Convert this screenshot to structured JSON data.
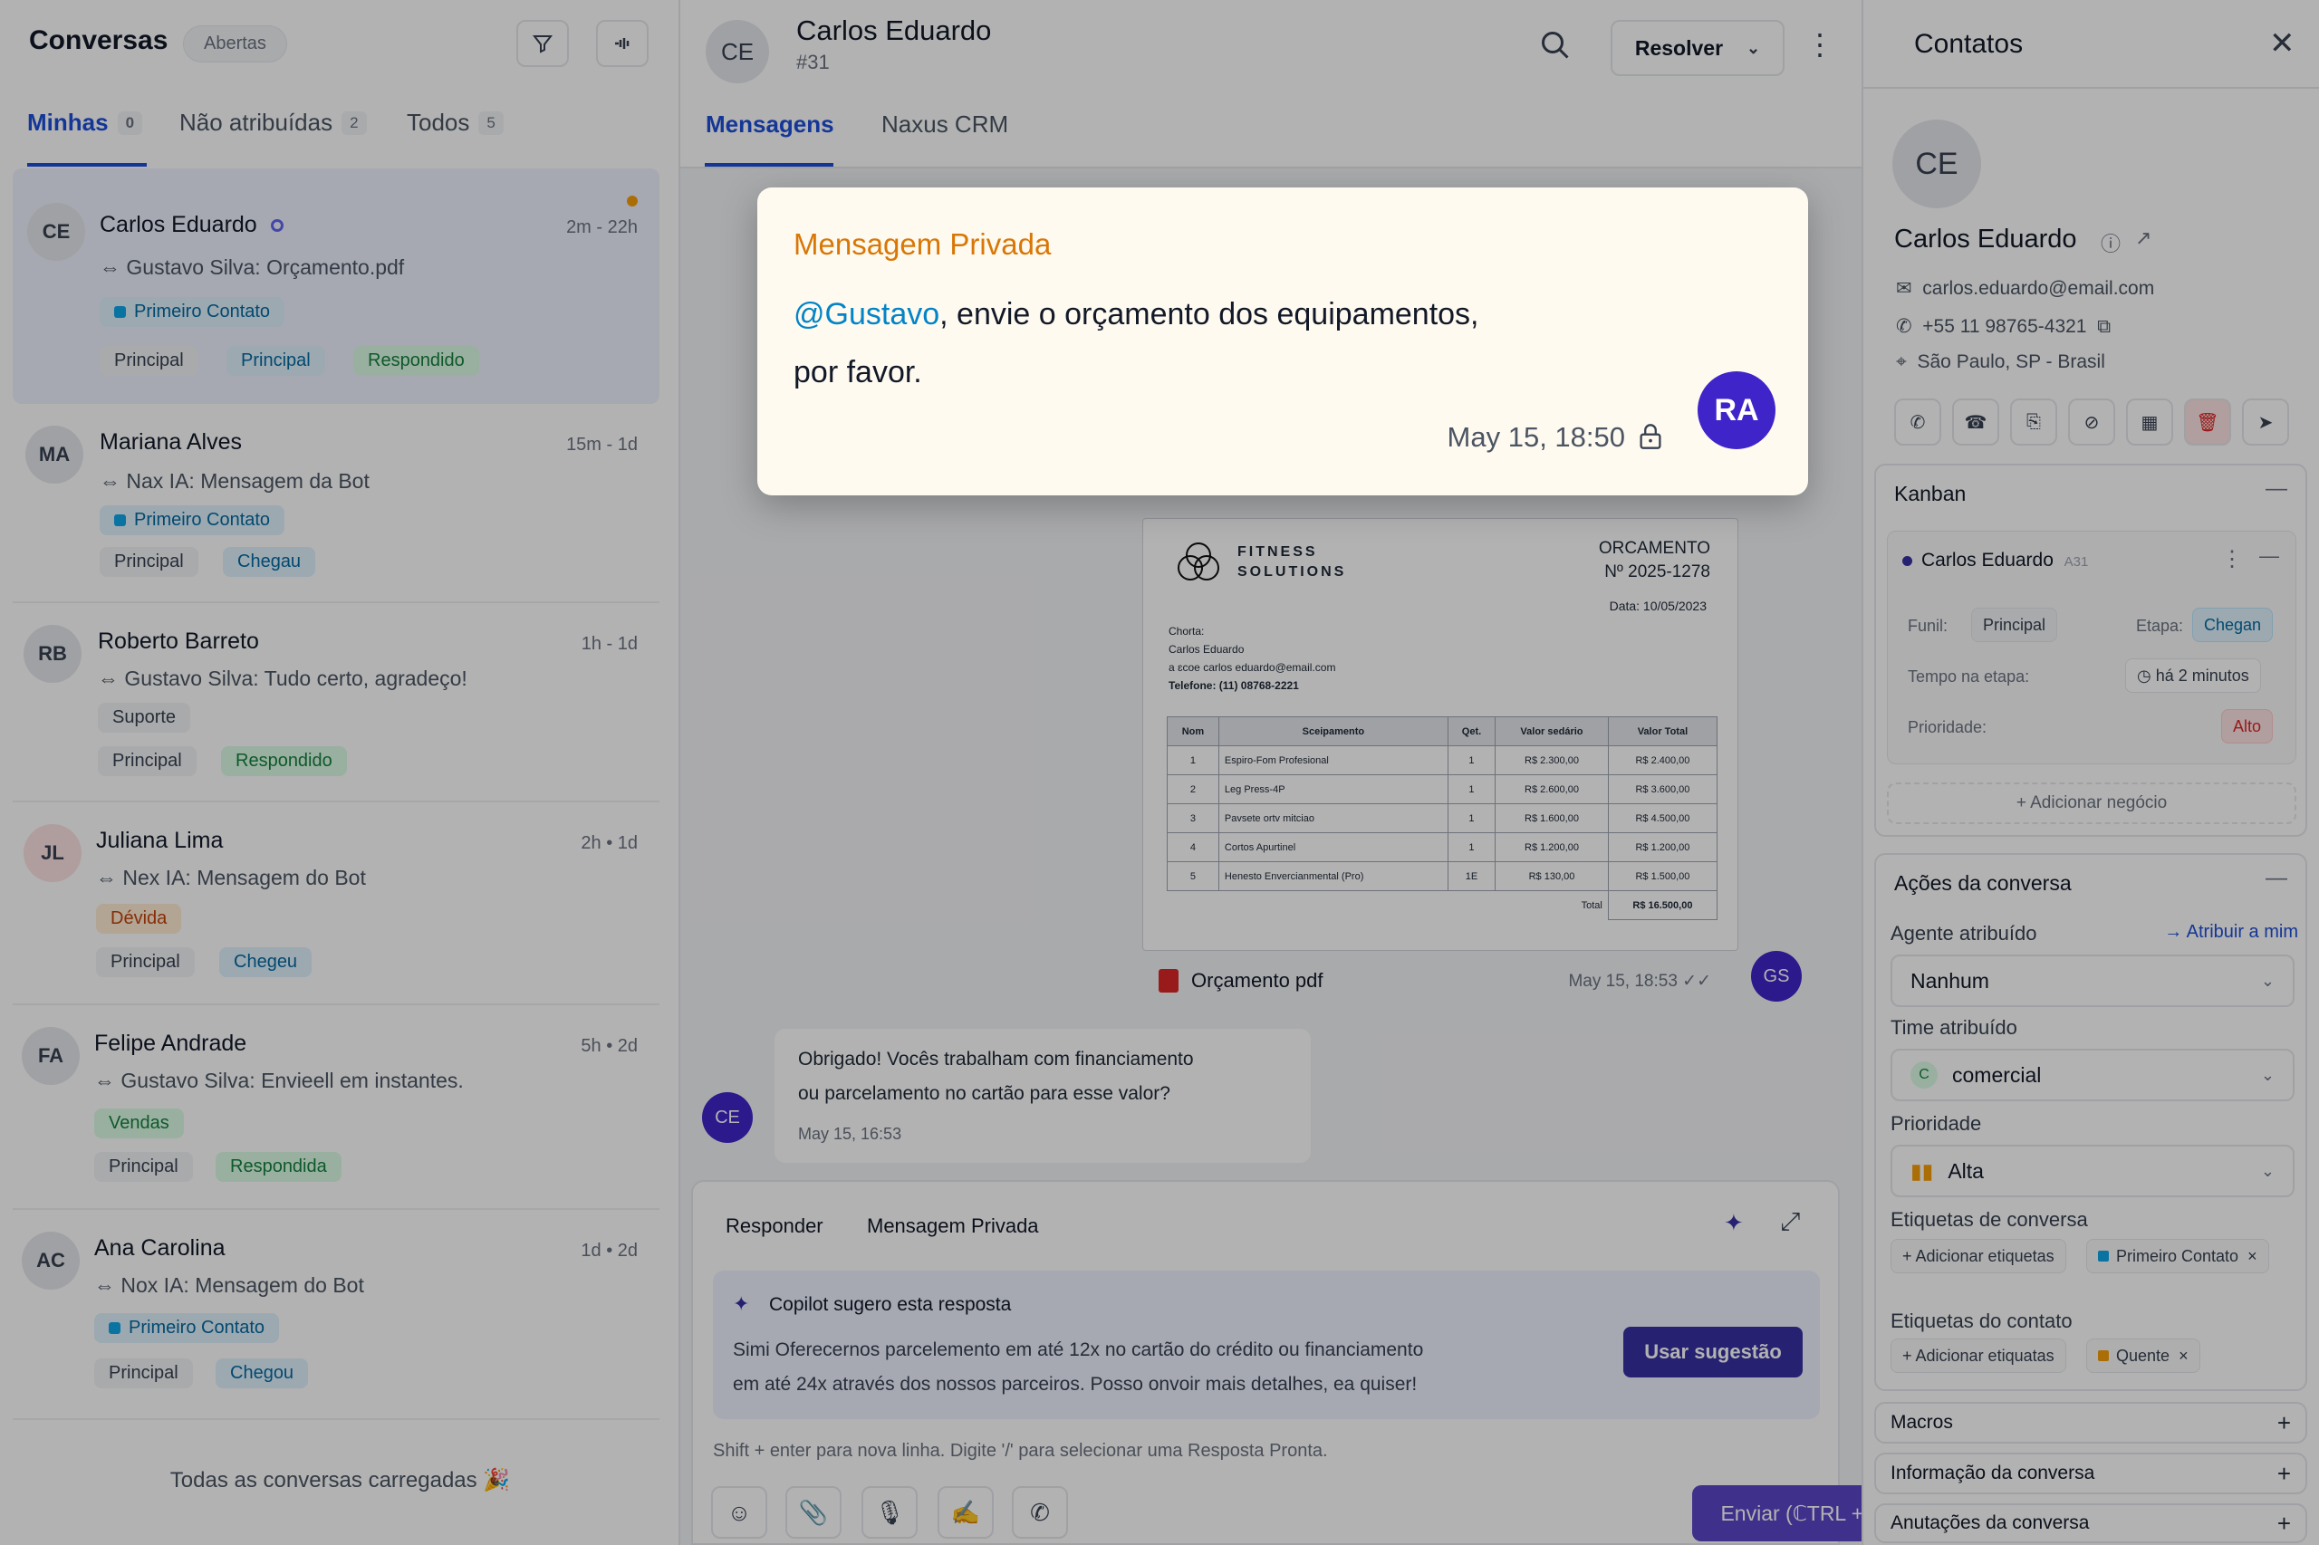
{
  "left": {
    "title": "Conversas",
    "status_pill": "Abertas",
    "filter_icon": "filter-icon",
    "sort_icon": "sort-icon",
    "tabs": [
      {
        "label": "Minhas",
        "count": "0"
      },
      {
        "label": "Não atribuídas",
        "count": "2"
      },
      {
        "label": "Todos",
        "count": "5"
      }
    ],
    "conversations": [
      {
        "initials": "CE",
        "name": "Carlos Eduardo",
        "time": "2m - 22h",
        "preview": "Gustavo Silva: Orçamento.pdf",
        "label": "Primeiro Contato",
        "tags": [
          "Principal",
          "Principal",
          "Respondido"
        ]
      },
      {
        "initials": "MA",
        "name": "Mariana Alves",
        "time": "15m - 1d",
        "preview": "Nax IA: Mensagem da Bot",
        "label": "Primeiro Contato",
        "tags": [
          "Principal",
          "Chegau"
        ]
      },
      {
        "initials": "RB",
        "name": "Roberto Barreto",
        "time": "1h - 1d",
        "preview": "Gustavo Silva: Tudo certo, agradeço!",
        "label": "Suporte",
        "tags": [
          "Principal",
          "Respondido"
        ]
      },
      {
        "initials": "JL",
        "name": "Juliana Lima",
        "time": "2h • 1d",
        "preview": "Nex IA: Mensagem do Bot",
        "label": "Dévida",
        "tags": [
          "Principal",
          "Chegeu"
        ]
      },
      {
        "initials": "FA",
        "name": "Felipe Andrade",
        "time": "5h • 2d",
        "preview": "Gustavo Silva: Envieell em instantes.",
        "label": "Vendas",
        "tags": [
          "Principal",
          "Respondida"
        ]
      },
      {
        "initials": "AC",
        "name": "Ana Carolina",
        "time": "1d • 2d",
        "preview": "Nox IA: Mensagem do Bot",
        "label": "Primeiro Contato",
        "tags": [
          "Principal",
          "Chegou"
        ]
      }
    ],
    "footer": "Todas as conversas carregadas 🎉"
  },
  "center": {
    "initials": "CE",
    "name": "Carlos Eduardo",
    "number": "#31",
    "resolve_label": "Resolver",
    "tabs": [
      "Mensagens",
      "Naxus CRM"
    ],
    "doc": {
      "brand1": "FITNESS",
      "brand2": "SOLUTIONS",
      "title": "ORCAMENTO",
      "num": "Nº 2025-1278",
      "date": "Data: 10/05/2023",
      "client_lines": [
        "Chorta:",
        "Carlos Eduardo",
        "a ɛcoe carlos eduardo@email.com",
        "Telefone: (11) 08768-2221"
      ],
      "headers": [
        "Nom",
        "Sceipamento",
        "Qet.",
        "Valor sedário",
        "Valor Total"
      ],
      "rows": [
        [
          "1",
          "Espiro-Fom Profesional",
          "1",
          "R$ 2.300,00",
          "R$ 2.400,00"
        ],
        [
          "2",
          "Leg Press-4P",
          "1",
          "R$ 2.600,00",
          "R$ 3.600,00"
        ],
        [
          "3",
          "Pavsete ortv mitciao",
          "1",
          "R$ 1.600,00",
          "R$ 4.500,00"
        ],
        [
          "4",
          "Cortos Apurtinel",
          "1",
          "R$ 1.200,00",
          "R$ 1.200,00"
        ],
        [
          "5",
          "Henesto Envercianmental (Pro)",
          "1E",
          "R$ 130,00",
          "R$ 1.500,00"
        ]
      ],
      "total_label": "Total",
      "total_value": "R$ 16.500,00"
    },
    "attachment": {
      "name": "Orçamento pdf",
      "time": "May 15, 18:53 ✓✓",
      "sender": "GS"
    },
    "incoming": {
      "initials": "CE",
      "text1": "Obrigado! Vocês trabalham com financiamento",
      "text2": "ou parcelamento no cartão para esse valor?",
      "time": "May 15, 16:53"
    },
    "composer": {
      "tab_reply": "Responder",
      "tab_private": "Mensagem Privada",
      "copilot_title": "Copilot sugero esta resposta",
      "copilot_text1": "Simi Oferecernos parcelemento em até 12x no cartão do crédito ou financiamento",
      "copilot_text2": "em até 24x através dos nossos parceiros. Posso onvoir mais detalhes, ea quiser!",
      "use_label": "Usar sugestão",
      "hint": "Shift + enter para nova linha. Digite '/' para selecionar uma Resposta Pronta.",
      "send_label": "Enviar (ℂTRL + ⏎)"
    }
  },
  "popup": {
    "title": "Mensagem Privada",
    "mention": "@Gustavo",
    "text_rest": ", envie o orçamento dos equipamentos,",
    "text_line2": "por favor.",
    "time": "May 15, 18:50",
    "avatar": "RA"
  },
  "right": {
    "title": "Contatos",
    "initials": "CE",
    "name": "Carlos Eduardo",
    "email": "carlos.eduardo@email.com",
    "phone": "+55 11 98765-4321",
    "location": "São Paulo, SP - Brasil",
    "kanban": {
      "title": "Kanban",
      "deal_name": "Carlos Eduardo",
      "deal_id": "A31",
      "funnel_label": "Funil:",
      "funnel_value": "Principal",
      "stage_label": "Etapa:",
      "stage_value": "Chegan",
      "time_label": "Tempo na etapa:",
      "time_value": "há 2 minutos",
      "priority_label": "Prioridade:",
      "priority_value": "Alto",
      "add_label": "+ Adicionar negócio"
    },
    "actions": {
      "title": "Ações da conversa",
      "agent_label": "Agente atribuído",
      "assign_me": "→ Atribuir a mim",
      "agent_value": "Nanhum",
      "team_label": "Time atribuído",
      "team_value": "comercial",
      "team_initial": "C",
      "priority_label": "Prioridade",
      "priority_value": "Alta",
      "conv_tags_label": "Etiquetas de conversa",
      "conv_add": "+ Adicionar etiquetas",
      "conv_tag": "Primeiro Contato",
      "contact_tags_label": "Etiquetas do contato",
      "contact_add": "+ Adicionar etiquatas",
      "contact_tag": "Quente"
    },
    "sections": [
      "Macros",
      "Informação da conversa",
      "Anutações da conversa"
    ]
  }
}
